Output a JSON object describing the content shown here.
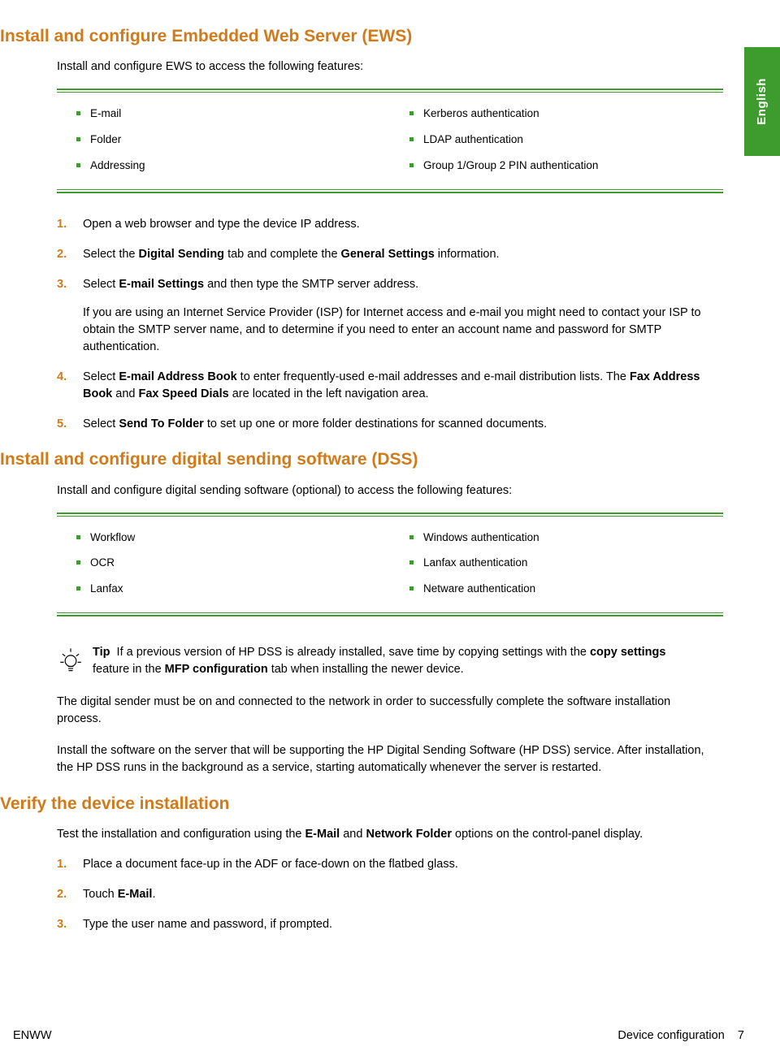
{
  "langTab": "English",
  "sec1": {
    "title": "Install and configure Embedded Web Server (EWS)",
    "intro": "Install and configure EWS to access the following features:",
    "left": [
      "E-mail",
      "Folder",
      "Addressing"
    ],
    "right": [
      "Kerberos authentication",
      "LDAP authentication",
      "Group 1/Group 2 PIN authentication"
    ]
  },
  "steps1": {
    "n1": "1.",
    "t1": "Open a web browser and type the device IP address.",
    "n2": "2.",
    "t2a": "Select the ",
    "t2b": "Digital Sending",
    "t2c": " tab and complete the ",
    "t2d": "General Settings",
    "t2e": " information.",
    "n3": "3.",
    "t3a": "Select ",
    "t3b": "E-mail Settings",
    "t3c": " and then type the SMTP server address.",
    "t3p2": "If you are using an Internet Service Provider (ISP) for Internet access and e-mail you might need to contact your ISP to obtain the SMTP server name, and to determine if you need to enter an account name and password for SMTP authentication.",
    "n4": "4.",
    "t4a": "Select ",
    "t4b": "E-mail Address Book",
    "t4c": " to enter frequently-used e-mail addresses and e-mail distribution lists. The ",
    "t4d": "Fax Address Book",
    "t4e": " and ",
    "t4f": "Fax Speed Dials",
    "t4g": " are located in the left navigation area.",
    "n5": "5.",
    "t5a": "Select ",
    "t5b": "Send To Folder",
    "t5c": " to set up one or more folder destinations for scanned documents."
  },
  "sec2": {
    "title": "Install and configure digital sending software (DSS)",
    "intro": "Install and configure digital sending software (optional) to access the following features:",
    "left": [
      "Workflow",
      "OCR",
      "Lanfax"
    ],
    "right": [
      "Windows authentication",
      "Lanfax authentication",
      "Netware authentication"
    ]
  },
  "tip": {
    "label": "Tip",
    "t1": "If a previous version of HP DSS is already installed, save time by copying settings with the ",
    "t2": "copy settings",
    "t3": " feature in the ",
    "t4": "MFP configuration",
    "t5": " tab when installing the newer device."
  },
  "para1": "The digital sender must be on and connected to the network in order to successfully complete the software installation process.",
  "para2": "Install the software on the server that will be supporting the HP Digital Sending Software (HP DSS) service. After installation, the HP DSS runs in the background as a service, starting automatically whenever the server is restarted.",
  "sec3": {
    "title": "Verify the device installation",
    "intro1": "Test the installation and configuration using the ",
    "intro2": "E-Mail",
    "intro3": " and ",
    "intro4": "Network Folder",
    "intro5": " options on the control-panel display."
  },
  "steps3": {
    "n1": "1.",
    "t1": "Place a document face-up in the ADF or face-down on the flatbed glass.",
    "n2": "2.",
    "t2a": "Touch ",
    "t2b": "E-Mail",
    "t2c": ".",
    "n3": "3.",
    "t3": "Type the user name and password, if prompted."
  },
  "footer": {
    "left": "ENWW",
    "right1": "Device configuration",
    "right2": "7"
  }
}
